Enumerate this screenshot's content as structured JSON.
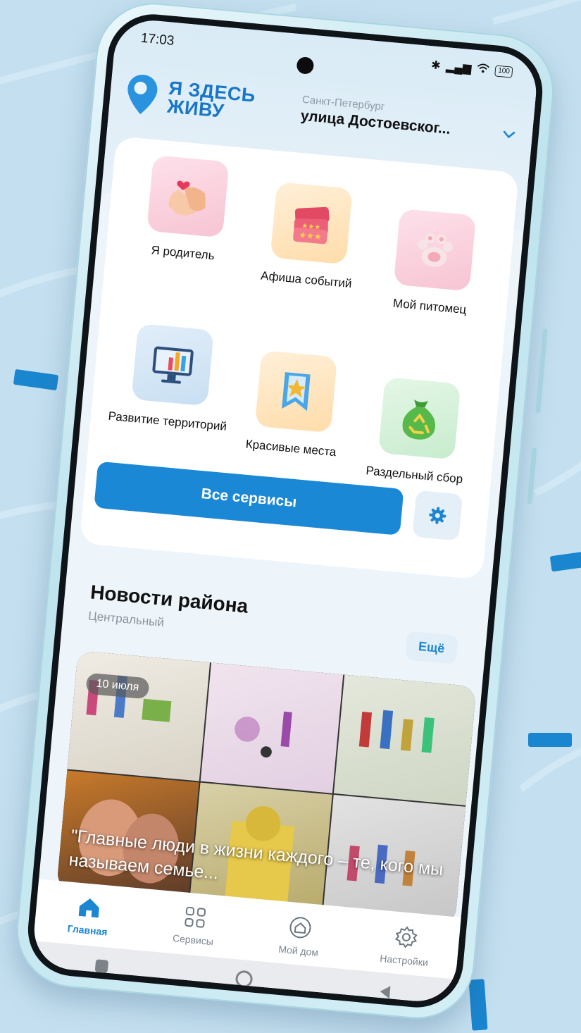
{
  "status_bar": {
    "time": "17:03",
    "battery": "100"
  },
  "app": {
    "logo_line1": "Я ЗДЕСЬ",
    "logo_line2": "ЖИВУ"
  },
  "location": {
    "city": "Санкт-Петербург",
    "street": "улица Достоевског..."
  },
  "services": [
    {
      "label": "Я родитель",
      "icon": "hands-heart-icon",
      "tile": "pink"
    },
    {
      "label": "Афиша событий",
      "icon": "tickets-icon",
      "tile": "orange"
    },
    {
      "label": "Мой питомец",
      "icon": "paw-icon",
      "tile": "pink"
    },
    {
      "label": "Развитие территорий",
      "icon": "monitor-chart-icon",
      "tile": "blue"
    },
    {
      "label": "Красивые места",
      "icon": "bookmark-star-icon",
      "tile": "orange"
    },
    {
      "label": "Раздельный сбор",
      "icon": "recycle-bag-icon",
      "tile": "green"
    }
  ],
  "all_services_label": "Все сервисы",
  "news": {
    "title": "Новости района",
    "district": "Центральный",
    "more_label": "Ещё",
    "date": "10 июля",
    "headline": "\"Главные люди в жизни каждого – те, кого мы называем семье..."
  },
  "tabs": [
    {
      "label": "Главная",
      "icon": "home-icon",
      "active": true
    },
    {
      "label": "Сервисы",
      "icon": "grid-icon",
      "active": false
    },
    {
      "label": "Мой дом",
      "icon": "house-circle-icon",
      "active": false
    },
    {
      "label": "Настройки",
      "icon": "settings-icon",
      "active": false
    }
  ],
  "colors": {
    "accent": "#1b88d6",
    "background": "#c4e0f0"
  }
}
